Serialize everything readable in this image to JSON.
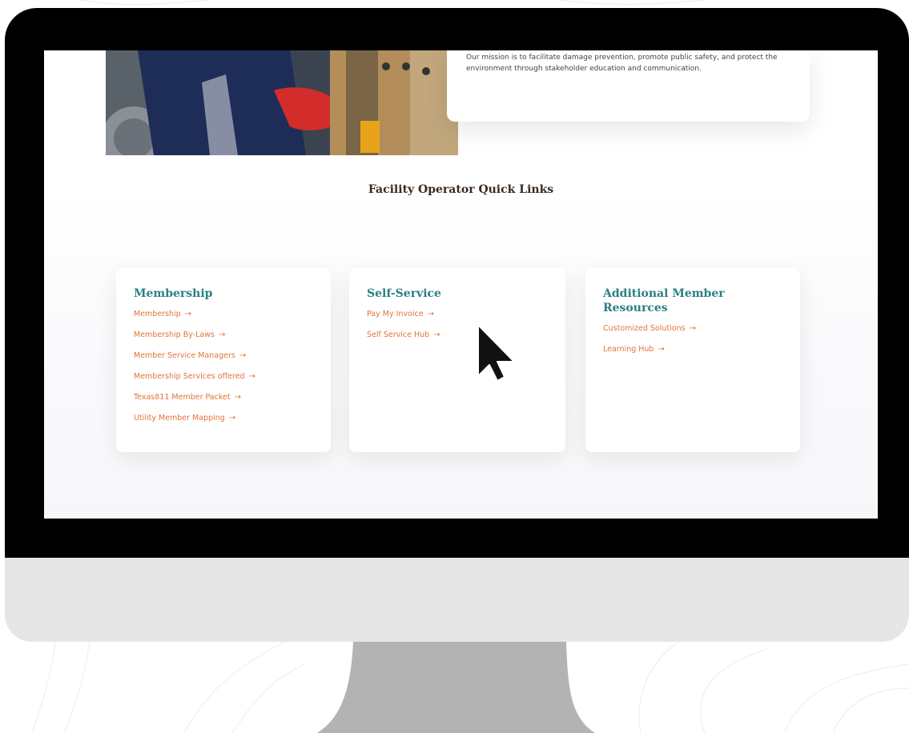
{
  "mission": {
    "text": "Our mission is to facilitate damage prevention, promote public safety, and protect the environment through stakeholder education and communication."
  },
  "quick_links": {
    "heading": "Facility Operator Quick Links",
    "arrow": "→",
    "cards": {
      "membership": {
        "title": "Membership",
        "links": [
          "Membership",
          "Membership By-Laws",
          "Member Service Managers",
          "Membership Services offered",
          "Texas811 Member Packet",
          "Utility Member Mapping"
        ]
      },
      "self_service": {
        "title": "Self-Service",
        "links": [
          "Pay My Invoice",
          "Self Service Hub"
        ]
      },
      "additional": {
        "title": "Additional Member Resources",
        "links": [
          "Customized Solutions",
          "Learning Hub"
        ]
      }
    }
  },
  "colors": {
    "card_title": "#2a7f83",
    "link": "#e2733a",
    "heading": "#3a2a22",
    "bezel": "#000000",
    "chin": "#e6e6e6",
    "stand": "#b3b3b3"
  },
  "icons": {
    "cursor": "mouse-pointer-icon",
    "arrow": "arrow-right-icon"
  }
}
